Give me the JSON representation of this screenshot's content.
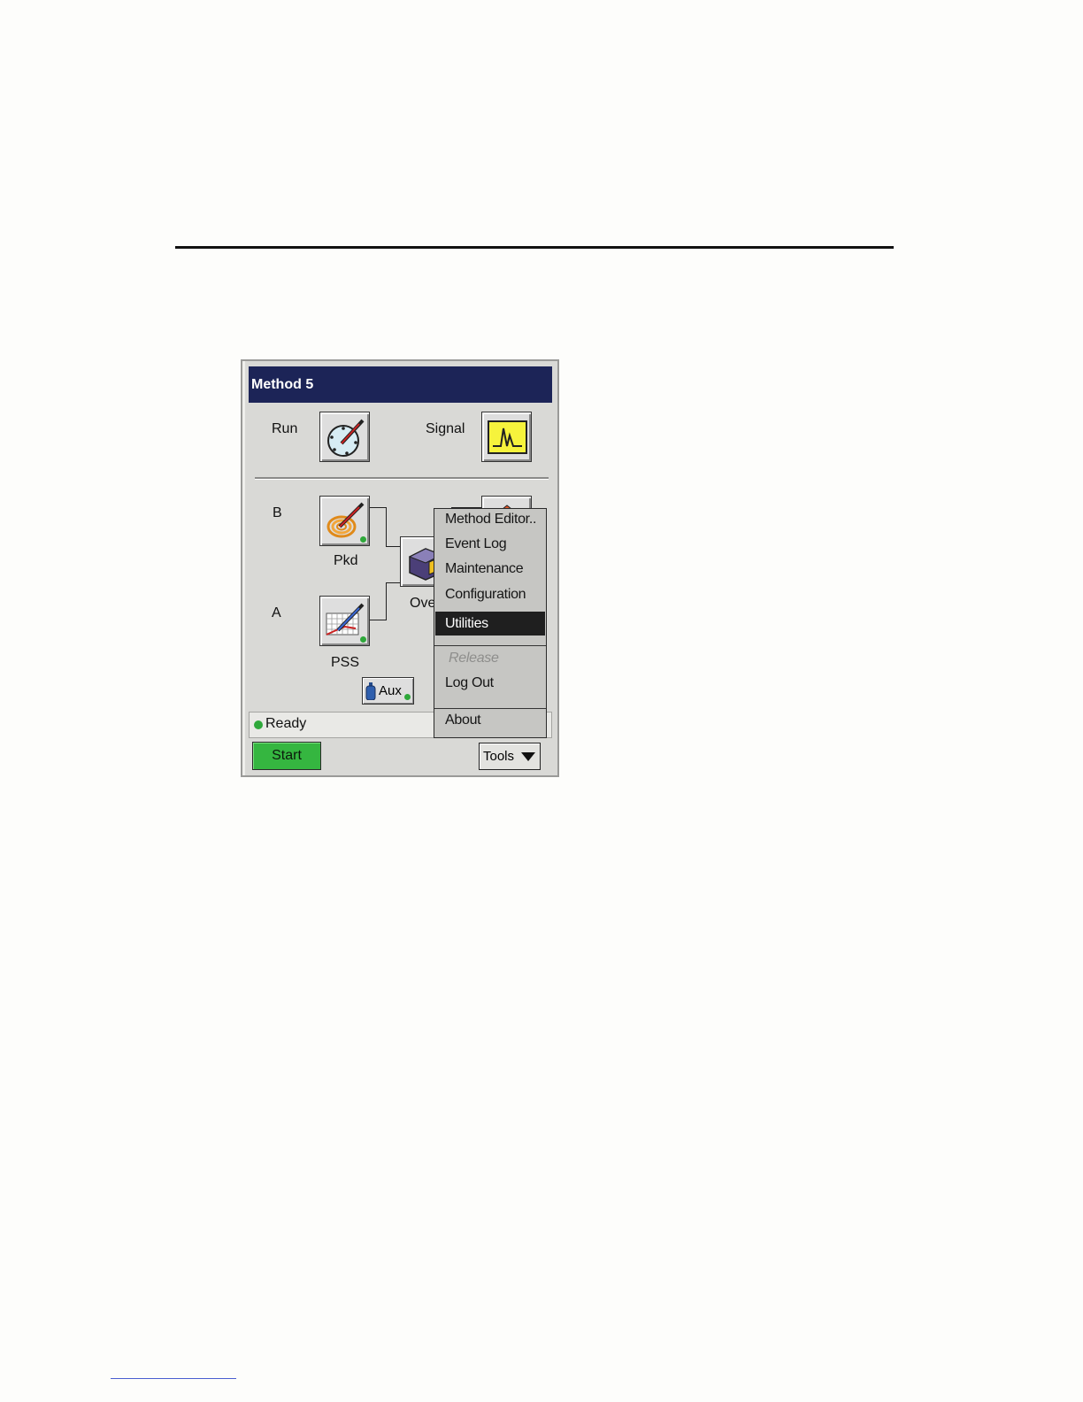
{
  "window": {
    "title": "Method 5",
    "top": {
      "run_label": "Run",
      "signal_label": "Signal"
    },
    "flow": {
      "row_b_label": "B",
      "row_a_label": "A",
      "pkd_label": "Pkd",
      "pss_label": "PSS",
      "oven_label": "Ove",
      "aux_label": "Aux"
    },
    "status": {
      "text": "Ready",
      "tail": "¦"
    },
    "start_label": "Start",
    "tools_label": "Tools",
    "menu": {
      "items": [
        "Method Editor..",
        "Event Log",
        "Maintenance",
        "Configuration",
        "Utilities"
      ],
      "selected": "Utilities",
      "release_label": "Release",
      "logout_label": "Log Out",
      "about_label": "About"
    }
  },
  "colors": {
    "titlebar": "#1c2457",
    "start_button": "#35b640",
    "status_led": "#2ea83a",
    "menu_highlight": "#1f1f1f"
  },
  "icons": [
    "injector-dial-icon",
    "signal-peak-icon",
    "coil-injector-icon",
    "pss-injector-icon",
    "oven-icon",
    "detector-icon",
    "aux-bottle-icon",
    "dropdown-arrow-icon"
  ]
}
